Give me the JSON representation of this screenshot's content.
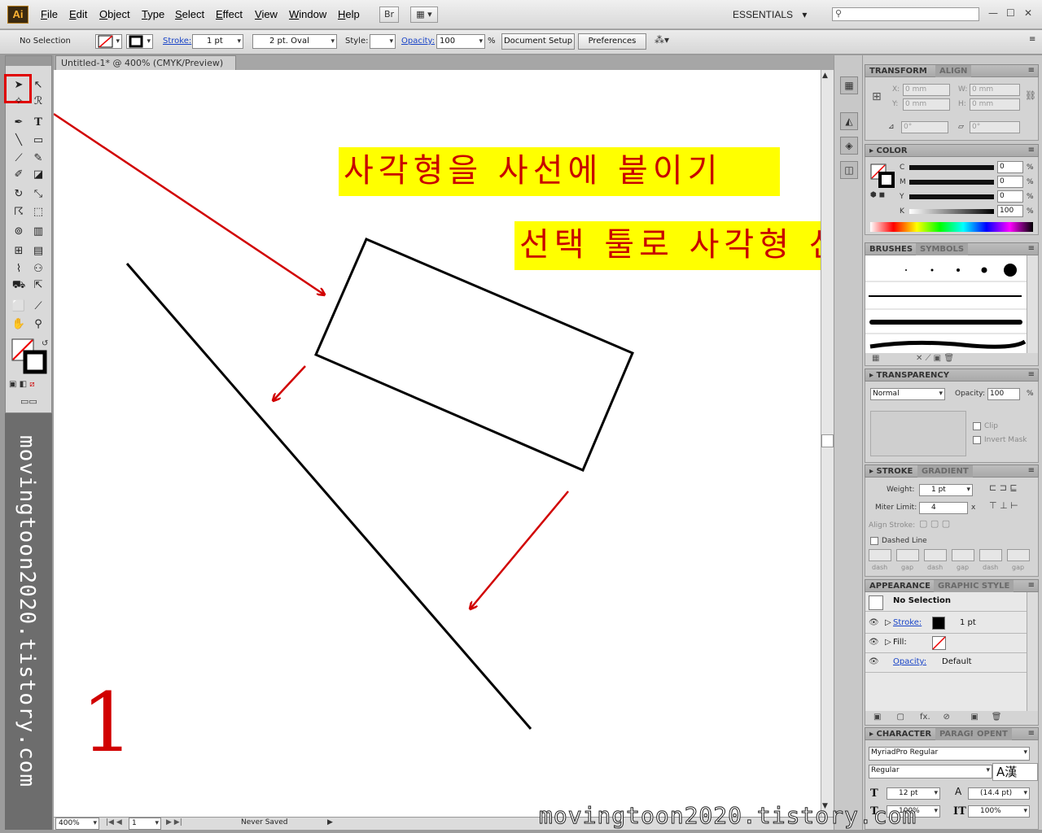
{
  "app": {
    "logo": "Ai",
    "workspace": "ESSENTIALS"
  },
  "menu": [
    "File",
    "Edit",
    "Object",
    "Type",
    "Select",
    "Effect",
    "View",
    "Window",
    "Help"
  ],
  "menu_extras": {
    "bridge": "Br"
  },
  "window_controls": {
    "minimize": "—",
    "maximize": "☐",
    "close": "✕"
  },
  "control_bar": {
    "selection": "No Selection",
    "stroke_label": "Stroke:",
    "stroke_weight": "1 pt",
    "brush": "2 pt. Oval",
    "style_label": "Style:",
    "opacity_label": "Opacity:",
    "opacity_value": "100",
    "percent": "%",
    "document_setup": "Document Setup",
    "preferences": "Preferences"
  },
  "document": {
    "tab_title": "Untitled-1* @ 400% (CMYK/Preview)"
  },
  "canvas": {
    "banner_1": "사각형을 사선에 붙이기",
    "banner_2": "선택 툴로 사각형 선택",
    "step_number": "1",
    "watermark": "movingtoon2020.tistory.com"
  },
  "sidebar_watermark": "movingtoon2020.tistory.com",
  "status_bar": {
    "zoom": "400%",
    "page": "1",
    "status": "Never Saved"
  },
  "panels": {
    "transform": {
      "tabs": [
        "TRANSFORM",
        "ALIGN"
      ],
      "x_label": "X:",
      "y_label": "Y:",
      "w_label": "W:",
      "h_label": "H:",
      "x": "0 mm",
      "y": "0 mm",
      "w": "0 mm",
      "h": "0 mm",
      "angle": "0°",
      "shear": "0°"
    },
    "color": {
      "title": "COLOR",
      "channels": [
        {
          "name": "C",
          "value": "0"
        },
        {
          "name": "M",
          "value": "0"
        },
        {
          "name": "Y",
          "value": "0"
        },
        {
          "name": "K",
          "value": "100"
        }
      ],
      "percent": "%"
    },
    "brushes": {
      "tabs": [
        "BRUSHES",
        "SYMBOLS"
      ]
    },
    "transparency": {
      "title": "TRANSPARENCY",
      "mode": "Normal",
      "opacity_label": "Opacity:",
      "opacity": "100",
      "percent": "%",
      "clip": "Clip",
      "invert_mask": "Invert Mask"
    },
    "stroke": {
      "tabs": [
        "STROKE",
        "GRADIENT"
      ],
      "weight_label": "Weight:",
      "weight": "1 pt",
      "miter_label": "Miter Limit:",
      "miter": "4",
      "miter_unit": "x",
      "align_label": "Align Stroke:",
      "dashed_line": "Dashed Line",
      "dash_fields": [
        "dash",
        "gap",
        "dash",
        "gap",
        "dash",
        "gap"
      ]
    },
    "appearance": {
      "tabs": [
        "APPEARANCE",
        "GRAPHIC STYLE"
      ],
      "title_row": "No Selection",
      "stroke_label": "Stroke:",
      "stroke_value": "1 pt",
      "fill_label": "Fill:",
      "opacity_label": "Opacity:",
      "opacity_value": "Default"
    },
    "character": {
      "tabs": [
        "CHARACTER",
        "PARAGRA",
        "OPENT"
      ],
      "font": "MyriadPro Regular",
      "style": "Regular",
      "size": "12 pt",
      "leading": "(14.4 pt)",
      "v_scale": "100%",
      "h_scale": "100%",
      "ime": "A漢"
    }
  },
  "colors": {
    "accent_red": "#d10000",
    "banner_yellow": "#ffff00",
    "tool_highlight": "#e00000"
  }
}
